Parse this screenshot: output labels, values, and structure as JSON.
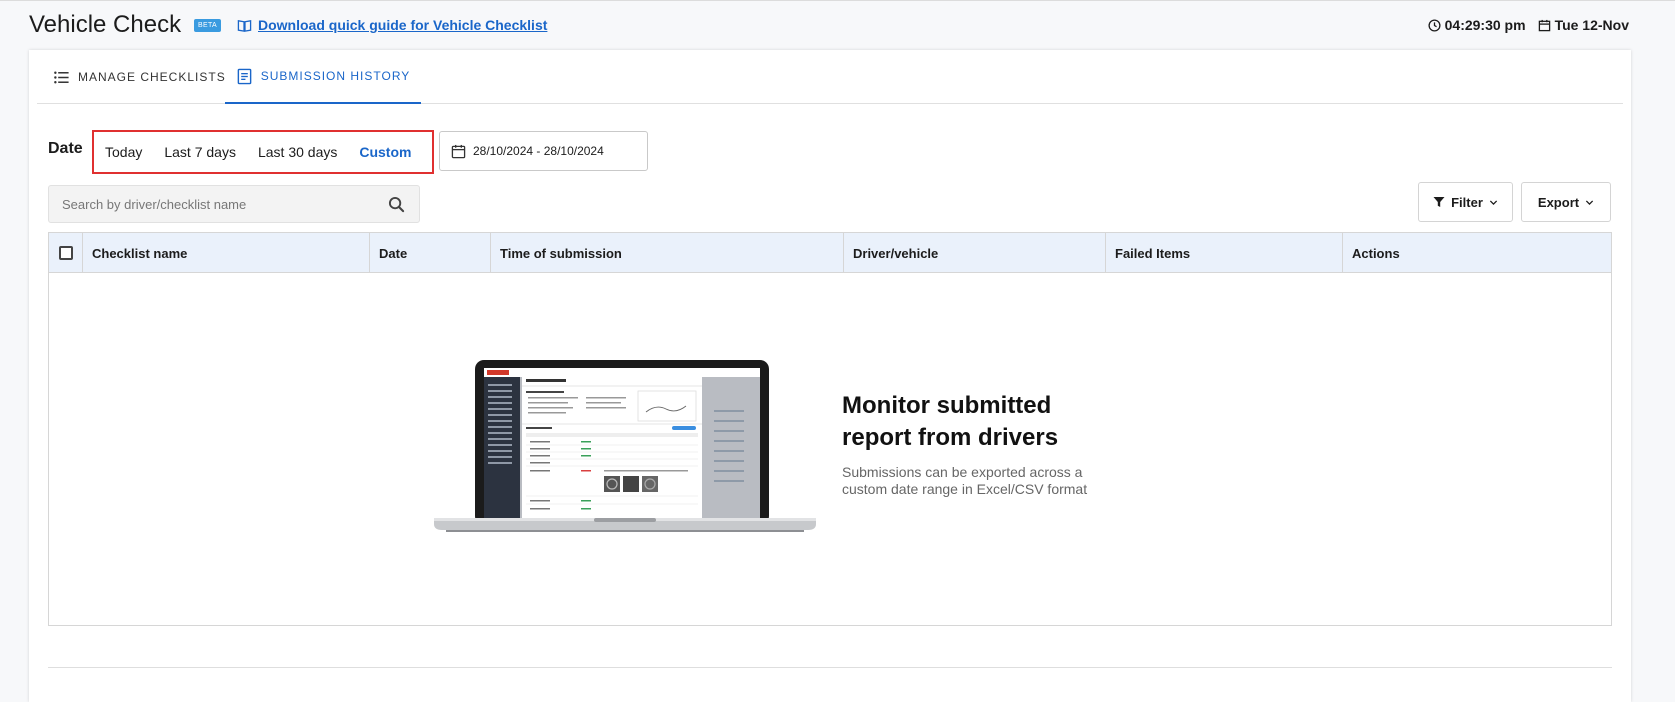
{
  "header": {
    "title": "Vehicle Check",
    "badge": "BETA",
    "guide_link": "Download quick guide for Vehicle Checklist",
    "time": "04:29:30 pm",
    "date": "Tue 12-Nov"
  },
  "tabs": [
    {
      "label": "MANAGE CHECKLISTS",
      "icon": "list-icon",
      "active": false
    },
    {
      "label": "SUBMISSION HISTORY",
      "icon": "document-icon",
      "active": true
    }
  ],
  "filters": {
    "date_label": "Date",
    "ranges": [
      {
        "label": "Today",
        "active": false
      },
      {
        "label": "Last 7 days",
        "active": false
      },
      {
        "label": "Last 30 days",
        "active": false
      },
      {
        "label": "Custom",
        "active": true
      }
    ],
    "date_range": "28/10/2024 - 28/10/2024"
  },
  "search": {
    "placeholder": "Search by driver/checklist name",
    "value": ""
  },
  "toolbar": {
    "filter_label": "Filter",
    "export_label": "Export"
  },
  "table": {
    "columns": [
      "Checklist name",
      "Date",
      "Time of submission",
      "Driver/vehicle",
      "Failed Items",
      "Actions"
    ],
    "rows": []
  },
  "empty_state": {
    "title": "Monitor submitted report from drivers",
    "subtitle": "Submissions can be exported across a custom date range in Excel/CSV format"
  },
  "colors": {
    "accent": "#1a66c9",
    "highlight": "#e03030",
    "header_bg": "#eaf1fb"
  }
}
